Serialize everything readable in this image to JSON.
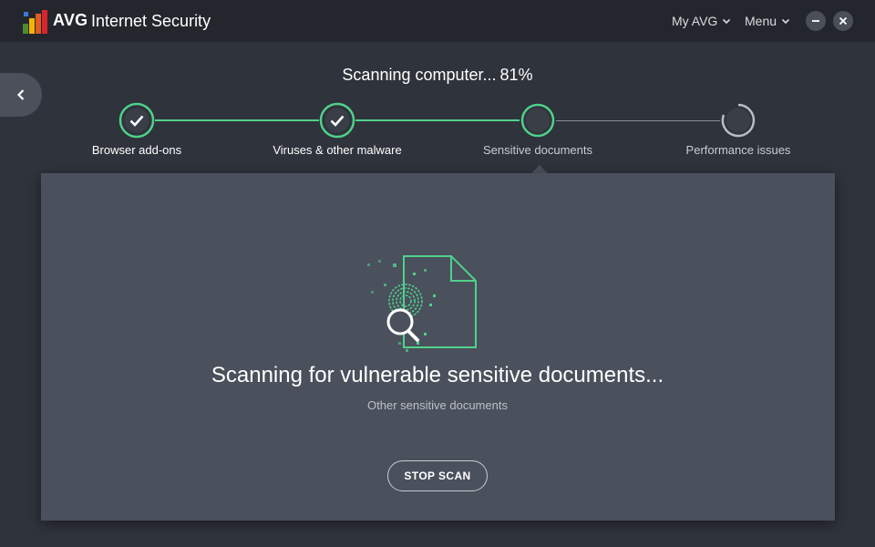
{
  "app": {
    "brand": "AVG",
    "product": "Internet Security"
  },
  "nav": {
    "my_avg": "My AVG",
    "menu": "Menu"
  },
  "scan": {
    "title": "Scanning computer...",
    "progress_text": "81%",
    "progress": 81
  },
  "steps": [
    {
      "label": "Browser add-ons",
      "status": "done"
    },
    {
      "label": "Viruses & other malware",
      "status": "done"
    },
    {
      "label": "Sensitive documents",
      "status": "active"
    },
    {
      "label": "Performance issues",
      "status": "pending"
    }
  ],
  "panel": {
    "message": "Scanning for vulnerable sensitive documents...",
    "detail": "Other sensitive documents",
    "stop_label": "STOP SCAN"
  },
  "colors": {
    "accent": "#4fd18b",
    "titlebar": "#23262c",
    "background": "#2f333b",
    "panel": "#4a505c",
    "muted": "#bcc1c9"
  },
  "icons": {
    "logo": "avg-logo-icon",
    "back": "chevron-left-icon",
    "minimize": "minimize-icon",
    "close": "close-icon",
    "done": "checkmark-icon",
    "illustration": "document-fingerprint-magnifier-icon"
  }
}
